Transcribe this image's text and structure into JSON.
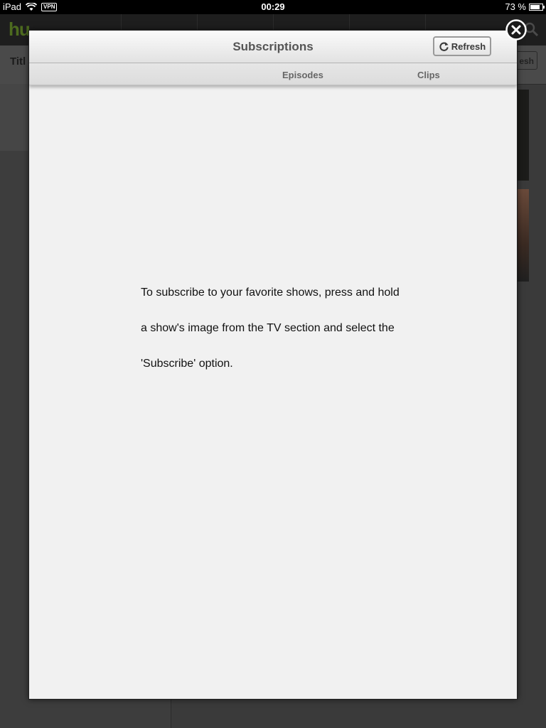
{
  "status_bar": {
    "device": "iPad",
    "vpn": "VPN",
    "time": "00:29",
    "battery_percent_label": "73 %",
    "battery_level": 0.73
  },
  "background": {
    "logo_text": "hu",
    "subbar_left_fragment": "Titl",
    "subbar_right_fragment": "esh"
  },
  "modal": {
    "title": "Subscriptions",
    "refresh_label": "Refresh",
    "tabs": [
      {
        "label": "Episodes"
      },
      {
        "label": "Clips"
      }
    ],
    "message_lines": [
      "To subscribe to your favorite shows, press and hold",
      "a show's image from the TV section and select the",
      "'Subscribe' option."
    ]
  }
}
